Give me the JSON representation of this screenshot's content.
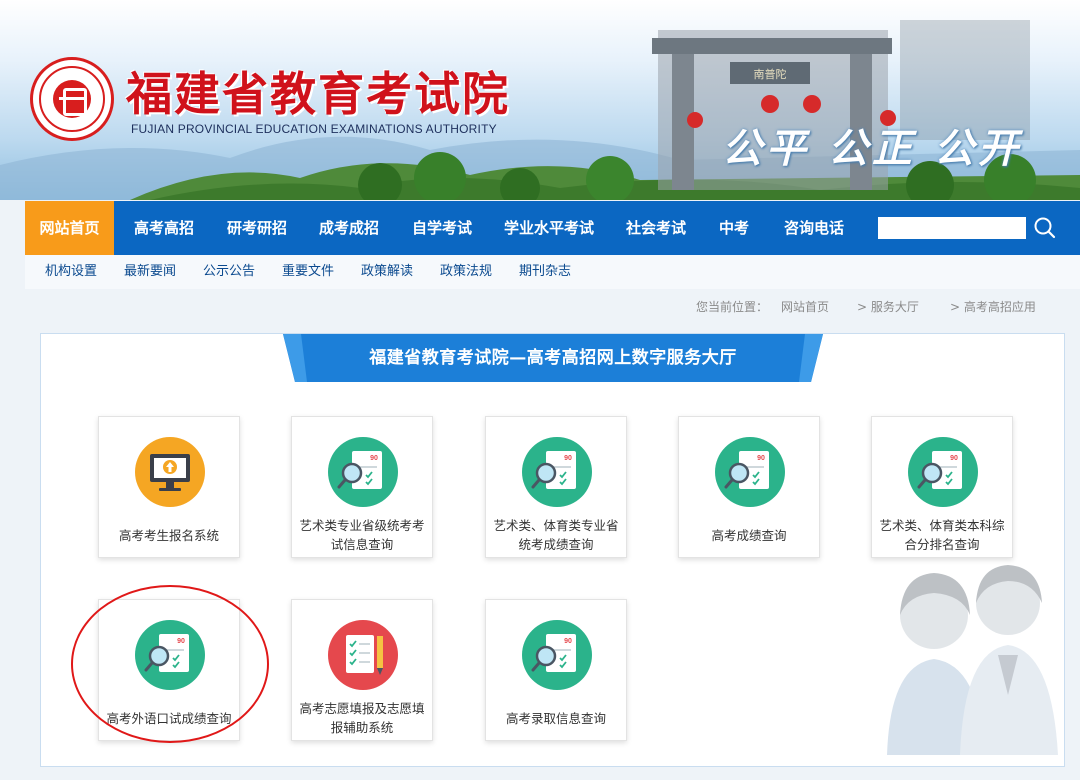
{
  "header": {
    "site_name": "福建省教育考试院",
    "site_name_en": "FUJIAN PROVINCIAL EDUCATION EXAMINATIONS AUTHORITY",
    "slogan": "公平 公正 公开",
    "gate_plaque": "南普陀"
  },
  "main_nav": {
    "items": [
      {
        "label": "网站首页",
        "active": true
      },
      {
        "label": "高考高招"
      },
      {
        "label": "研考研招"
      },
      {
        "label": "成考成招"
      },
      {
        "label": "自学考试"
      },
      {
        "label": "学业水平考试"
      },
      {
        "label": "社会考试"
      },
      {
        "label": "中考"
      },
      {
        "label": "咨询电话"
      }
    ],
    "search_value": ""
  },
  "sub_nav": {
    "items": [
      {
        "label": "机构设置"
      },
      {
        "label": "最新要闻"
      },
      {
        "label": "公示公告"
      },
      {
        "label": "重要文件"
      },
      {
        "label": "政策解读"
      },
      {
        "label": "政策法规"
      },
      {
        "label": "期刊杂志"
      }
    ]
  },
  "breadcrumb": {
    "prefix": "您当前位置：",
    "items": [
      {
        "label": "网站首页"
      },
      {
        "label": "> 服务大厅"
      },
      {
        "label": "> 高考高招应用"
      }
    ]
  },
  "panel": {
    "title": "福建省教育考试院—高考高招网上数字服务大厅",
    "cards": [
      {
        "label": "高考考生报名系统",
        "icon": "upload-computer-icon"
      },
      {
        "label": "艺术类专业省级统考考试信息查询",
        "icon": "score-query-icon"
      },
      {
        "label": "艺术类、体育类专业省统考成绩查询",
        "icon": "score-query-icon"
      },
      {
        "label": "高考成绩查询",
        "icon": "score-query-icon"
      },
      {
        "label": "艺术类、体育类本科综合分排名查询",
        "icon": "score-query-icon"
      },
      {
        "label": "高考外语口试成绩查询",
        "icon": "score-query-icon",
        "highlighted": true
      },
      {
        "label": "高考志愿填报及志愿填报辅助系统",
        "icon": "form-pencil-icon"
      },
      {
        "label": "高考录取信息查询",
        "icon": "score-query-icon"
      }
    ],
    "score_badge": "90"
  },
  "colors": {
    "nav_blue": "#0b67c2",
    "active_orange": "#f89b1a",
    "brand_red": "#d0121b",
    "icon_green": "#2bb38b",
    "icon_yellow": "#f5a623",
    "icon_red": "#e5484d"
  }
}
